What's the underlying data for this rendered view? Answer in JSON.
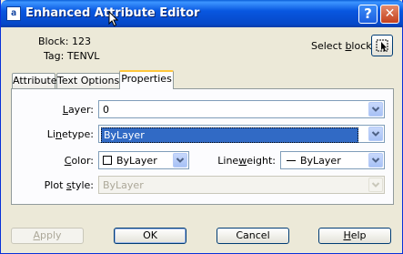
{
  "window": {
    "title": "Enhanced Attribute Editor",
    "help_glyph": "?",
    "close_glyph": "✕"
  },
  "block": {
    "label": "Block: 123",
    "tag_label": "Tag: TENVL"
  },
  "select_block": {
    "label": "Select block"
  },
  "tabs": [
    {
      "label": "Attribute"
    },
    {
      "label": "Text Options"
    },
    {
      "label": "Properties"
    }
  ],
  "properties": {
    "layer": {
      "label": "Layer:",
      "value": "0"
    },
    "linetype": {
      "label": "Linetype:",
      "value": "ByLayer"
    },
    "color": {
      "label": "Color:",
      "value": "ByLayer"
    },
    "lineweight": {
      "label": "Lineweight:",
      "value": "ByLayer"
    },
    "plot_style": {
      "label": "Plot style:",
      "value": "ByLayer"
    }
  },
  "buttons": {
    "apply": "Apply",
    "ok": "OK",
    "cancel": "Cancel",
    "help": "Help"
  },
  "colors": {
    "titlebar": "#0857e0",
    "selection": "#316ac5",
    "tab_highlight": "#ffc73c"
  }
}
